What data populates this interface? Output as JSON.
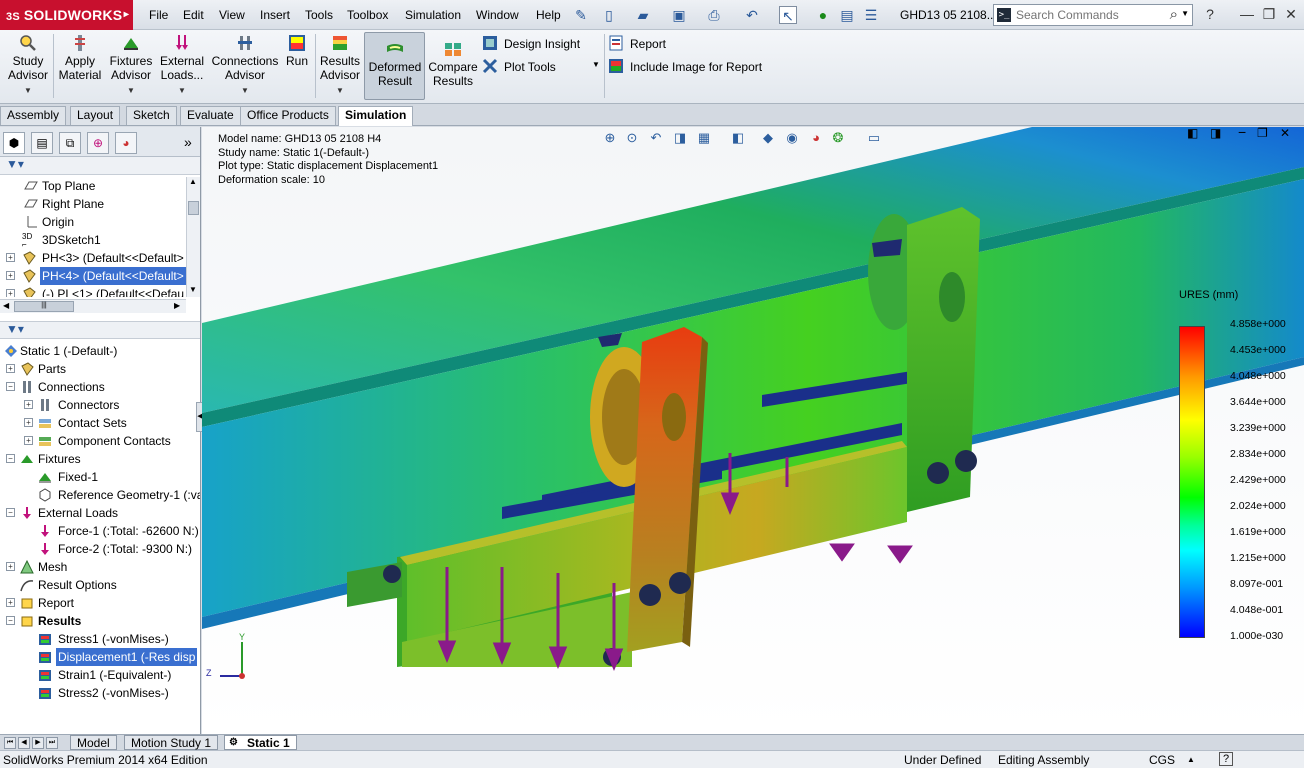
{
  "app": {
    "logo": "SOLIDWORKS",
    "logo_prefix": "3S",
    "document_title": "GHD13 05 2108...",
    "search_placeholder": "Search Commands"
  },
  "menu": [
    "File",
    "Edit",
    "View",
    "Insert",
    "Tools",
    "Toolbox",
    "Simulation",
    "Window",
    "Help"
  ],
  "ribbon": {
    "study_advisor": [
      "Study",
      "Advisor"
    ],
    "apply_material": [
      "Apply",
      "Material"
    ],
    "fixtures_advisor": [
      "Fixtures",
      "Advisor"
    ],
    "external_loads": [
      "External",
      "Loads..."
    ],
    "connections_advisor": [
      "Connections",
      "Advisor"
    ],
    "run": "Run",
    "results_advisor": [
      "Results",
      "Advisor"
    ],
    "deformed_result": [
      "Deformed",
      "Result"
    ],
    "compare_results": [
      "Compare",
      "Results"
    ],
    "design_insight": "Design Insight",
    "plot_tools": "Plot Tools",
    "report": "Report",
    "include_image": "Include Image for Report"
  },
  "command_tabs": [
    "Assembly",
    "Layout",
    "Sketch",
    "Evaluate",
    "Office Products",
    "Simulation"
  ],
  "active_command_tab": "Simulation",
  "feature_tree_top": [
    {
      "label": "Top Plane",
      "icon": "plane-icon"
    },
    {
      "label": "Right Plane",
      "icon": "plane-icon"
    },
    {
      "label": "Origin",
      "icon": "origin-icon"
    },
    {
      "label": "3DSketch1",
      "icon": "sketch-icon"
    },
    {
      "label": "PH<3> (Default<<Default>",
      "icon": "part-icon"
    },
    {
      "label": "PH<4> (Default<<Default>",
      "icon": "part-icon",
      "selected": true
    },
    {
      "label": "(-) PL<1> (Default<<Defau",
      "icon": "part-icon"
    }
  ],
  "sim_tree": [
    {
      "label": "Static 1 (-Default-)",
      "icon": "study-icon",
      "level": 0
    },
    {
      "label": "Parts",
      "icon": "parts-icon",
      "level": 0
    },
    {
      "label": "Connections",
      "icon": "connections-icon",
      "level": 0
    },
    {
      "label": "Connectors",
      "icon": "connector-icon",
      "level": 1
    },
    {
      "label": "Contact Sets",
      "icon": "contact-icon",
      "level": 1
    },
    {
      "label": "Component Contacts",
      "icon": "contact-icon",
      "level": 1
    },
    {
      "label": "Fixtures",
      "icon": "fixture-icon",
      "level": 0
    },
    {
      "label": "Fixed-1",
      "icon": "fixed-icon",
      "level": 1
    },
    {
      "label": "Reference Geometry-1 (:va",
      "icon": "refgeom-icon",
      "level": 1
    },
    {
      "label": "External Loads",
      "icon": "load-icon",
      "level": 0
    },
    {
      "label": "Force-1 (:Total: -62600 N:)",
      "icon": "force-icon",
      "level": 1
    },
    {
      "label": "Force-2 (:Total: -9300 N:)",
      "icon": "force-icon",
      "level": 1
    },
    {
      "label": "Mesh",
      "icon": "mesh-icon",
      "level": 0
    },
    {
      "label": "Result Options",
      "icon": "result-options-icon",
      "level": 0
    },
    {
      "label": "Report",
      "icon": "report-icon",
      "level": 0
    },
    {
      "label": "Results",
      "icon": "results-icon",
      "level": 0,
      "bold": true
    },
    {
      "label": "Stress1 (-vonMises-)",
      "icon": "stress-icon",
      "level": 1
    },
    {
      "label": "Displacement1 (-Res disp",
      "icon": "displacement-icon",
      "level": 1,
      "selected": true
    },
    {
      "label": "Strain1 (-Equivalent-)",
      "icon": "strain-icon",
      "level": 1
    },
    {
      "label": "Stress2 (-vonMises-)",
      "icon": "stress-icon",
      "level": 1
    }
  ],
  "plot_info": {
    "model_name": "Model name: GHD13 05 2108 H4",
    "study_name": "Study name: Static 1(-Default-)",
    "plot_type": "Plot type: Static displacement Displacement1",
    "deformation_scale": "Deformation scale: 10"
  },
  "legend": {
    "title": "URES (mm)",
    "labels": [
      "4.858e+000",
      "4.453e+000",
      "4.048e+000",
      "3.644e+000",
      "3.239e+000",
      "2.834e+000",
      "2.429e+000",
      "2.024e+000",
      "1.619e+000",
      "1.215e+000",
      "8.097e-001",
      "4.048e-001",
      "1.000e-030"
    ]
  },
  "triad": {
    "x": "Z",
    "y": "Y"
  },
  "bottom_tabs": [
    "Model",
    "Motion Study 1",
    "Static 1"
  ],
  "active_bottom_tab": "Static 1",
  "status": {
    "edition": "SolidWorks Premium 2014 x64 Edition",
    "state": "Under Defined",
    "mode": "Editing Assembly",
    "units": "CGS",
    "help": "?"
  }
}
